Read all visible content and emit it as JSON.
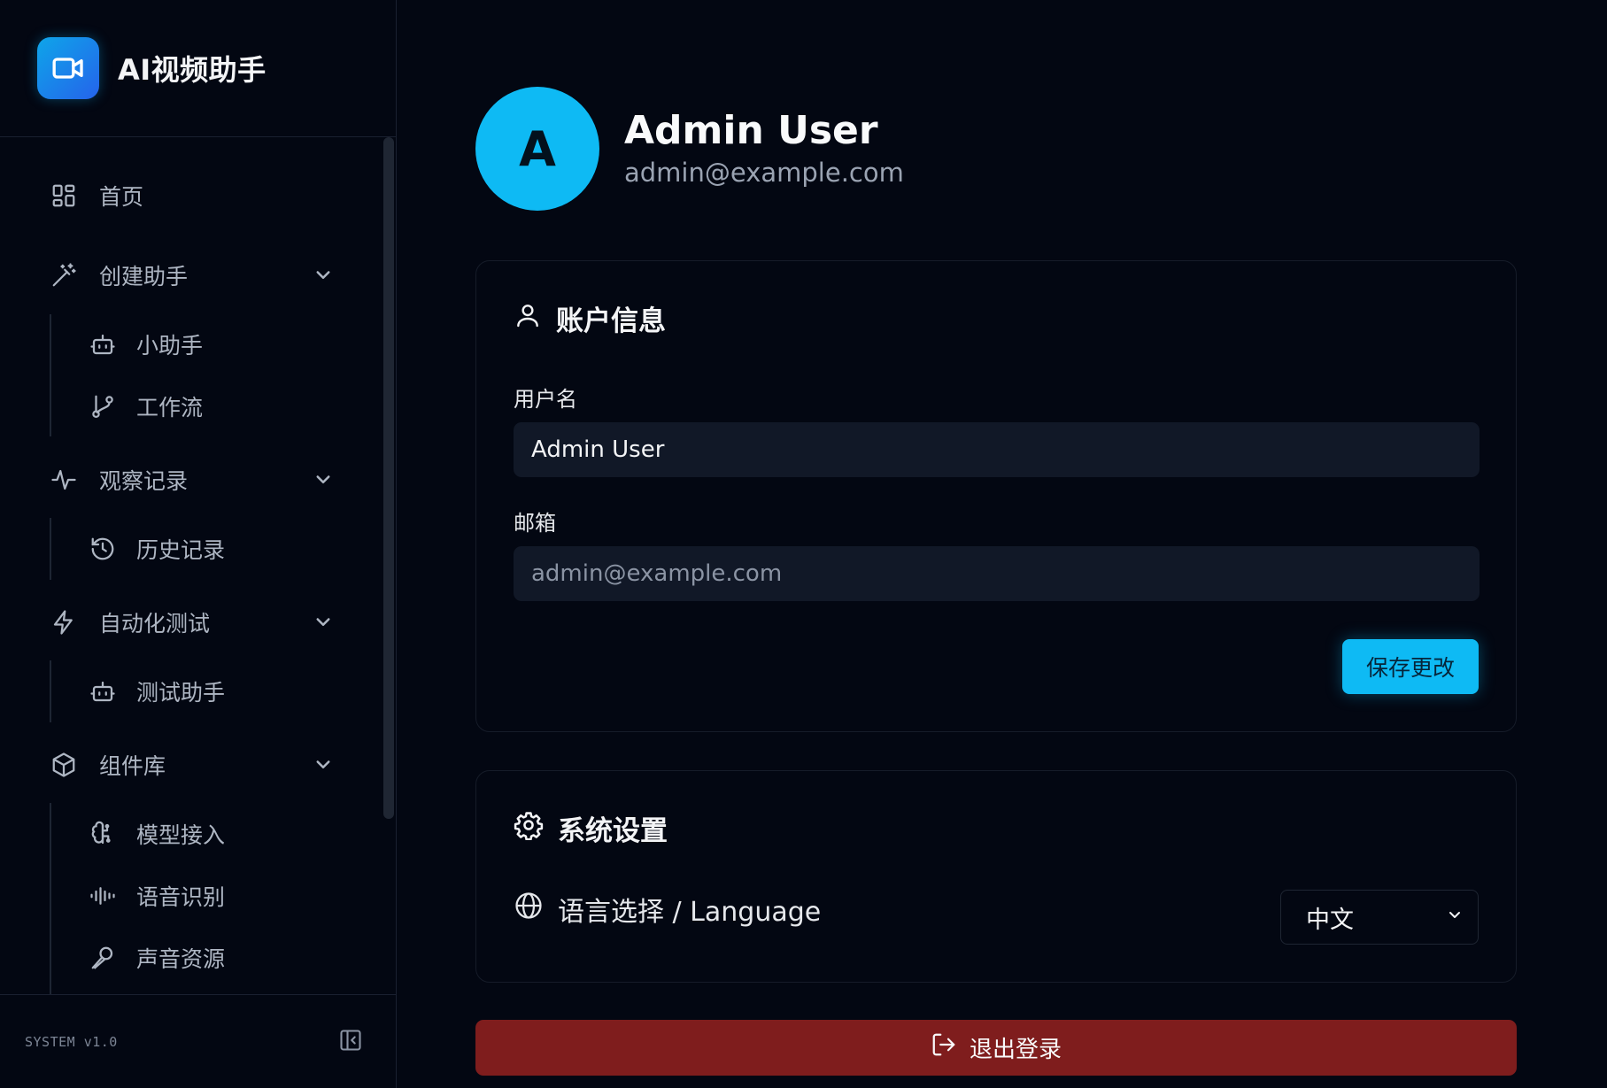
{
  "app": {
    "title": "AI视频助手",
    "version": "SYSTEM v1.0",
    "logo_icon": "video-camera-icon"
  },
  "sidebar": {
    "items": [
      {
        "label": "首页",
        "icon": "dashboard-grid-icon"
      },
      {
        "label": "创建助手",
        "icon": "magic-wand-icon",
        "expanded": true,
        "children": [
          {
            "label": "小助手",
            "icon": "bot-icon"
          },
          {
            "label": "工作流",
            "icon": "git-branch-icon"
          }
        ]
      },
      {
        "label": "观察记录",
        "icon": "activity-pulse-icon",
        "expanded": true,
        "children": [
          {
            "label": "历史记录",
            "icon": "history-icon"
          }
        ]
      },
      {
        "label": "自动化测试",
        "icon": "lightning-icon",
        "expanded": true,
        "children": [
          {
            "label": "测试助手",
            "icon": "bot-icon"
          }
        ]
      },
      {
        "label": "组件库",
        "icon": "package-cube-icon",
        "expanded": true,
        "children": [
          {
            "label": "模型接入",
            "icon": "brain-icon"
          },
          {
            "label": "语音识别",
            "icon": "audio-waveform-icon"
          },
          {
            "label": "声音资源",
            "icon": "microphone-icon"
          }
        ]
      }
    ]
  },
  "profile": {
    "avatar_letter": "A",
    "name": "Admin User",
    "email": "admin@example.com"
  },
  "account": {
    "title": "账户信息",
    "username_label": "用户名",
    "username_value": "Admin User",
    "email_label": "邮箱",
    "email_value": "admin@example.com",
    "save_label": "保存更改"
  },
  "settings": {
    "title": "系统设置",
    "language_label": "语言选择 / Language",
    "language_value": "中文"
  },
  "logout_label": "退出登录",
  "colors": {
    "accent": "#0ebaf4",
    "danger": "#7f1d1d",
    "background": "#030712",
    "input_bg": "#111827"
  }
}
